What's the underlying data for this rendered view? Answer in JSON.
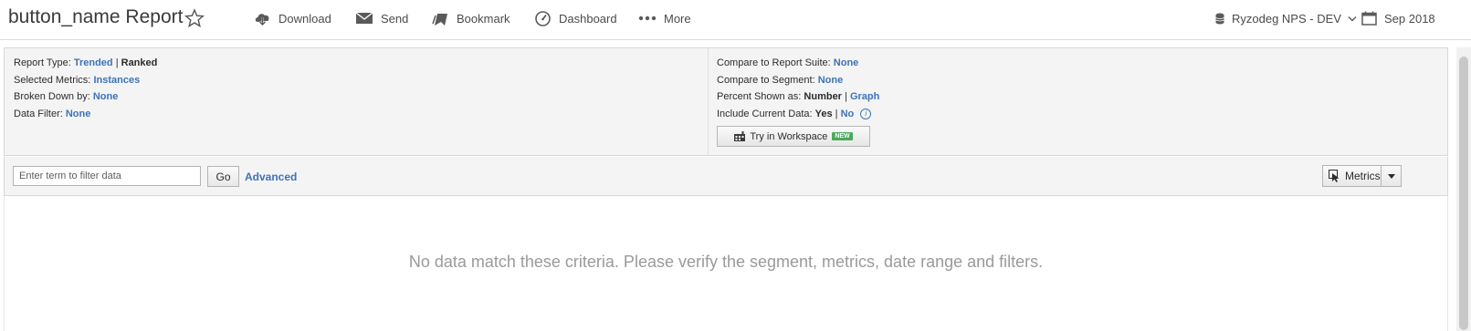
{
  "header": {
    "title": "button_name Report",
    "toolbar": [
      {
        "label": "Download",
        "icon": "cloud-download-icon"
      },
      {
        "label": "Send",
        "icon": "envelope-icon"
      },
      {
        "label": "Bookmark",
        "icon": "bookmark-icon"
      },
      {
        "label": "Dashboard",
        "icon": "gauge-icon"
      },
      {
        "label": "More",
        "icon": "ellipsis-icon"
      }
    ],
    "report_suite": "Ryzodeg NPS - DEV",
    "date": "Sep 2018"
  },
  "settings": {
    "left": {
      "report_type_label": "Report Type:",
      "report_type_trended": "Trended",
      "report_type_ranked": "Ranked",
      "selected_metrics_label": "Selected Metrics:",
      "selected_metrics_value": "Instances",
      "broken_down_label": "Broken Down by:",
      "broken_down_value": "None",
      "data_filter_label": "Data Filter:",
      "data_filter_value": "None"
    },
    "right": {
      "compare_suite_label": "Compare to Report Suite:",
      "compare_suite_value": "None",
      "compare_segment_label": "Compare to Segment:",
      "compare_segment_value": "None",
      "percent_label": "Percent Shown as:",
      "percent_number": "Number",
      "percent_graph": "Graph",
      "include_current_label": "Include Current Data:",
      "include_yes": "Yes",
      "include_no": "No",
      "workspace_button": "Try in Workspace",
      "new_badge": "NEW"
    }
  },
  "filter": {
    "placeholder": "Enter term to filter data",
    "go_label": "Go",
    "advanced_label": "Advanced",
    "metrics_label": "Metrics"
  },
  "content": {
    "message": "No data match these criteria. Please verify the segment, metrics, date range and filters."
  },
  "colors": {
    "link": "#3e73b7",
    "panel_bg": "#f4f4f4",
    "badge_green": "#4aaa5a"
  }
}
